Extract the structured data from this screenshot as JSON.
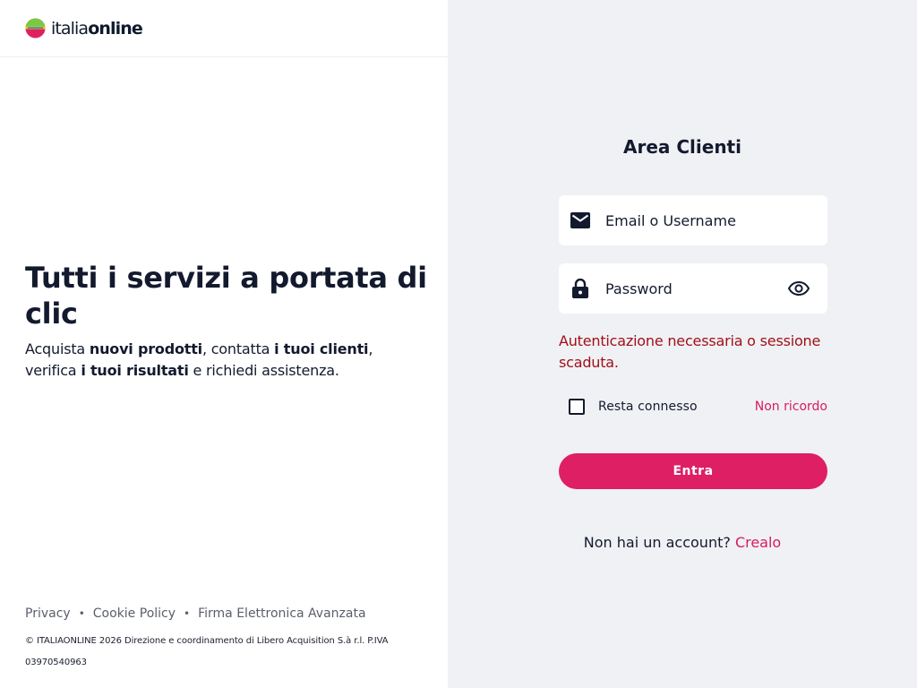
{
  "brand": {
    "logo_text_light": "italia",
    "logo_text_bold": "online",
    "logo_colors": [
      "#7ac943",
      "#f7c600",
      "#e0215f",
      "#1e88e5"
    ]
  },
  "hero": {
    "title": "Tutti i servizi a portata di clic",
    "desc_1": "Acquista ",
    "desc_b1": "nuovi prodotti",
    "desc_2": ", contatta ",
    "desc_b2": "i tuoi clienti",
    "desc_3": ", verifica ",
    "desc_b3": "i tuoi risultati",
    "desc_4": " e richiedi assistenza."
  },
  "footer": {
    "links": [
      "Privacy",
      "Cookie Policy",
      "Firma Elettronica Avanzata"
    ],
    "separator": "•",
    "copyright": "© ITALIAONLINE 2026 Direzione e coordinamento di Libero Acquisition S.à r.l. P.IVA 03970540963"
  },
  "login": {
    "title": "Area Clienti",
    "email_placeholder": "Email o Username",
    "password_placeholder": "Password",
    "error": "Autenticazione necessaria o sessione scaduta.",
    "remember_label": "Resta connesso",
    "forgot_label": "Non ricordo",
    "submit_label": "Entra",
    "signup_prompt": "Non hai un account?",
    "signup_link": "Crealo"
  },
  "colors": {
    "accent": "#de1f63",
    "error": "#a0101a",
    "panel_bg": "#f0f1f4",
    "text": "#131a2e"
  },
  "icons": {
    "email": "envelope-icon",
    "password": "lock-icon",
    "toggle": "eye-icon"
  }
}
